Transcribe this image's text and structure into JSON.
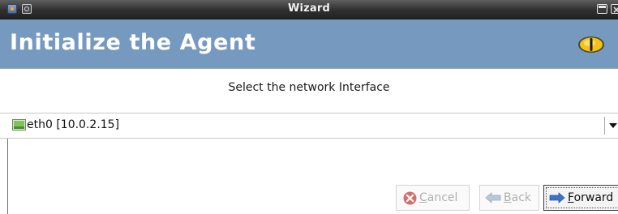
{
  "window": {
    "title": "Wizard",
    "close_glyph": "×"
  },
  "header": {
    "title": "Initialize the Agent",
    "icon": "eye-icon"
  },
  "body": {
    "prompt": "Select the network Interface",
    "interface_select": {
      "selected": "eth0 [10.0.2.15]",
      "icon": "network-interface-icon"
    }
  },
  "buttons": {
    "cancel": {
      "mnemonic": "C",
      "rest": "ancel",
      "icon": "cancel-icon",
      "enabled": false
    },
    "back": {
      "mnemonic": "B",
      "rest": "ack",
      "icon": "back-arrow-icon",
      "enabled": false
    },
    "forward": {
      "mnemonic": "F",
      "rest": "orward",
      "icon": "forward-arrow-icon",
      "enabled": true
    }
  },
  "colors": {
    "banner": "#7699c0",
    "titlebar": "#2f2f2f",
    "forward_arrow": "#3d74c6",
    "cancel_icon": "#d56e6e"
  }
}
